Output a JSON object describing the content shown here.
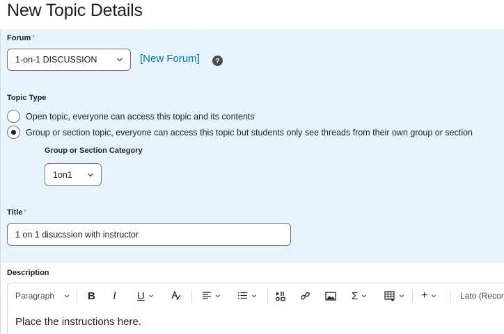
{
  "page": {
    "title": "New Topic Details"
  },
  "forum": {
    "label": "Forum",
    "required_marker": "*",
    "selected": "1-on-1 DISCUSSION",
    "new_forum_link": "[New Forum]",
    "help_glyph": "?"
  },
  "topic_type": {
    "label": "Topic Type",
    "options": [
      {
        "label": "Open topic, everyone can access this topic and its contents",
        "selected": false
      },
      {
        "label": "Group or section topic, everyone can access this topic but students only see threads from their own group or section",
        "selected": true
      }
    ],
    "category_label": "Group or Section Category",
    "category_selected": "1on1"
  },
  "title_field": {
    "label": "Title",
    "required_marker": "*",
    "value": "1 on 1 disucssion with instructor"
  },
  "description": {
    "label": "Description",
    "toolbar": {
      "format_select": "Paragraph",
      "bold": "B",
      "italic": "I",
      "underline": "U",
      "sigma": "Σ",
      "plus": "+",
      "font_select": "Lato (Recom..."
    },
    "body_text": "Place the instructions here."
  },
  "colors": {
    "accent": "#006fbf",
    "panel_bg": "#e8f4fc",
    "border": "#6e7477"
  }
}
